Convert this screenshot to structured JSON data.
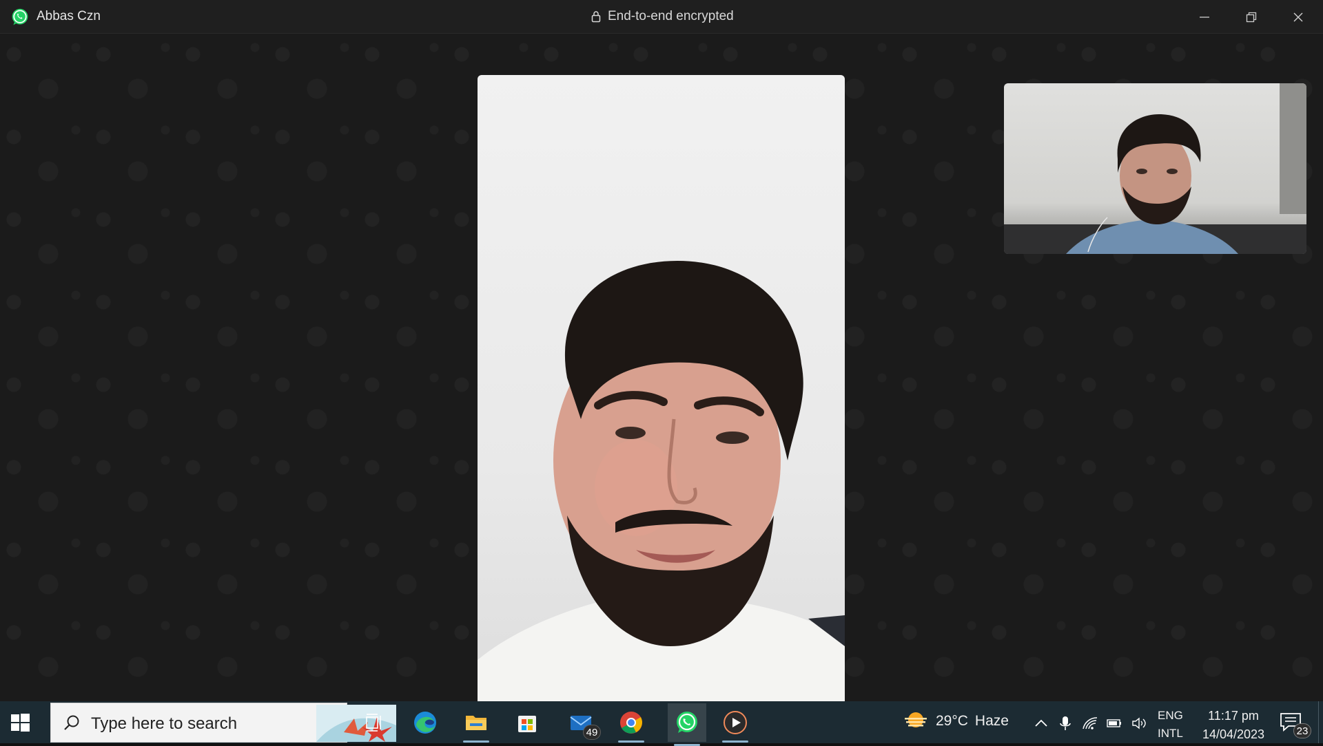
{
  "window": {
    "contact_name": "Abbas Czn",
    "encryption_status": "End-to-end encrypted",
    "controls": {
      "minimize_icon": "minimize-icon",
      "restore_icon": "restore-icon",
      "close_icon": "close-icon"
    }
  },
  "call": {
    "remote_video": "remote-participant-video",
    "self_video": "self-preview-video"
  },
  "taskbar": {
    "search_placeholder": "Type here to search",
    "apps": [
      {
        "name": "task-view",
        "icon": "task-view-icon"
      },
      {
        "name": "edge",
        "icon": "edge-icon"
      },
      {
        "name": "file-explorer",
        "icon": "folder-icon"
      },
      {
        "name": "microsoft-store",
        "icon": "store-icon"
      },
      {
        "name": "mail",
        "icon": "mail-icon",
        "badge": "49"
      },
      {
        "name": "chrome",
        "icon": "chrome-icon"
      },
      {
        "name": "whatsapp",
        "icon": "whatsapp-icon"
      },
      {
        "name": "media-player",
        "icon": "play-icon"
      }
    ],
    "weather": {
      "temp": "29°C",
      "condition": "Haze"
    },
    "language": {
      "line1": "ENG",
      "line2": "INTL"
    },
    "clock": {
      "time": "11:17 pm",
      "date": "14/04/2023"
    },
    "notifications_count": "23"
  },
  "colors": {
    "titlebar_bg": "#1f1f1f",
    "call_bg": "#1b1b1b",
    "taskbar_bg": "#1c2b33",
    "whatsapp_green": "#25d366"
  }
}
